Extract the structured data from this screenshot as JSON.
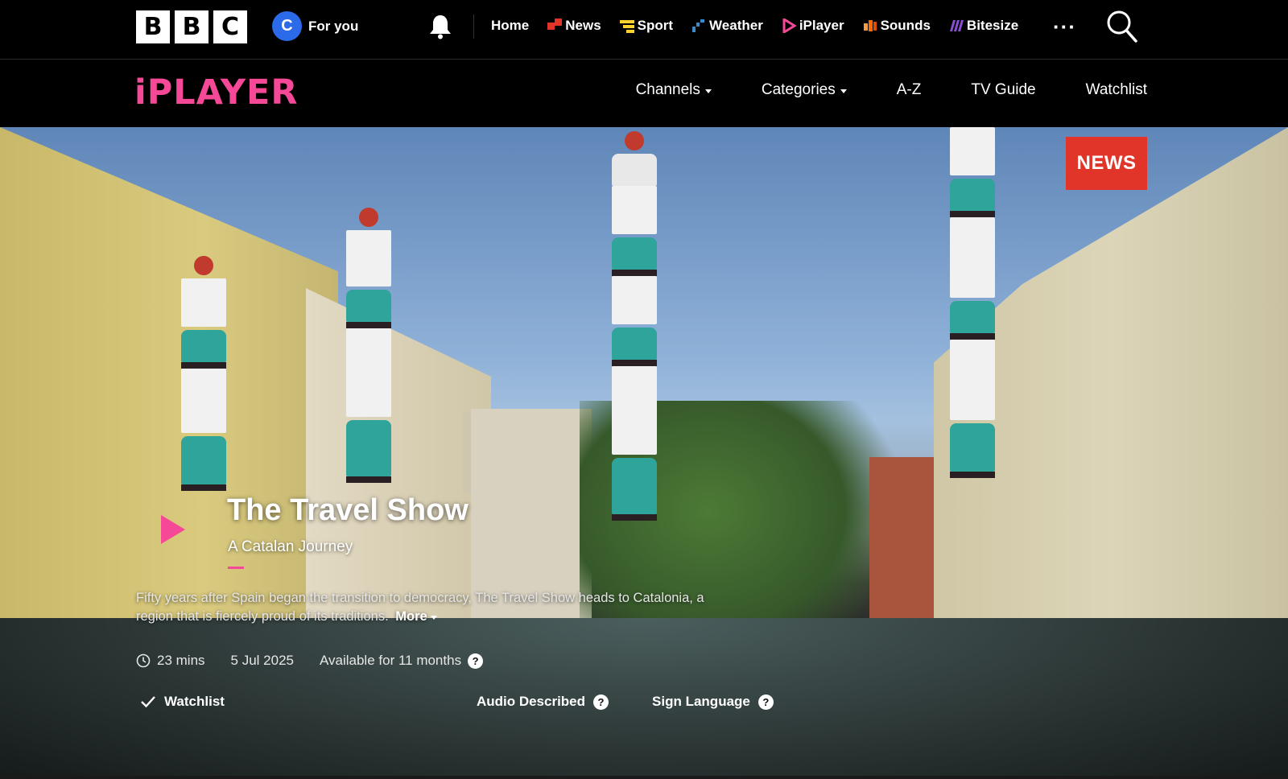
{
  "bbc": {
    "logo_letters": [
      "B",
      "B",
      "C"
    ],
    "foryou": {
      "avatar_letter": "C",
      "label": "For you"
    },
    "nav": [
      {
        "label": "Home",
        "icon": "",
        "color": ""
      },
      {
        "label": "News",
        "icon": "news-icon",
        "color": "#e2352a"
      },
      {
        "label": "Sport",
        "icon": "sport-icon",
        "color": "#ffd230"
      },
      {
        "label": "Weather",
        "icon": "weather-icon",
        "color": "#3a89c9"
      },
      {
        "label": "iPlayer",
        "icon": "iplayer-icon",
        "color": "#f54997"
      },
      {
        "label": "Sounds",
        "icon": "sounds-icon",
        "color": "#ff6b00"
      },
      {
        "label": "Bitesize",
        "icon": "bitesize-icon",
        "color": "#8a4fd6"
      }
    ],
    "more": "···"
  },
  "iplayer": {
    "logo": "iPLAYER",
    "subnav": [
      {
        "label": "Channels",
        "dropdown": true
      },
      {
        "label": "Categories",
        "dropdown": true
      },
      {
        "label": "A-Z",
        "dropdown": false
      },
      {
        "label": "TV Guide",
        "dropdown": false
      },
      {
        "label": "Watchlist",
        "dropdown": false
      }
    ]
  },
  "hero": {
    "badge": "NEWS",
    "title": "The Travel Show",
    "subtitle": "A Catalan Journey",
    "description": "Fifty years after Spain began the transition to democracy, The Travel Show heads to Catalonia, a region that is fiercely proud of its traditions.",
    "more_label": "More",
    "duration": "23 mins",
    "date": "5 Jul 2025",
    "availability": "Available for 11 months",
    "actions": {
      "watchlist": "Watchlist",
      "audio_described": "Audio Described",
      "sign_language": "Sign Language"
    },
    "help_glyph": "?"
  },
  "colors": {
    "iplayer_pink": "#f54997",
    "news_red": "#e2352a"
  }
}
